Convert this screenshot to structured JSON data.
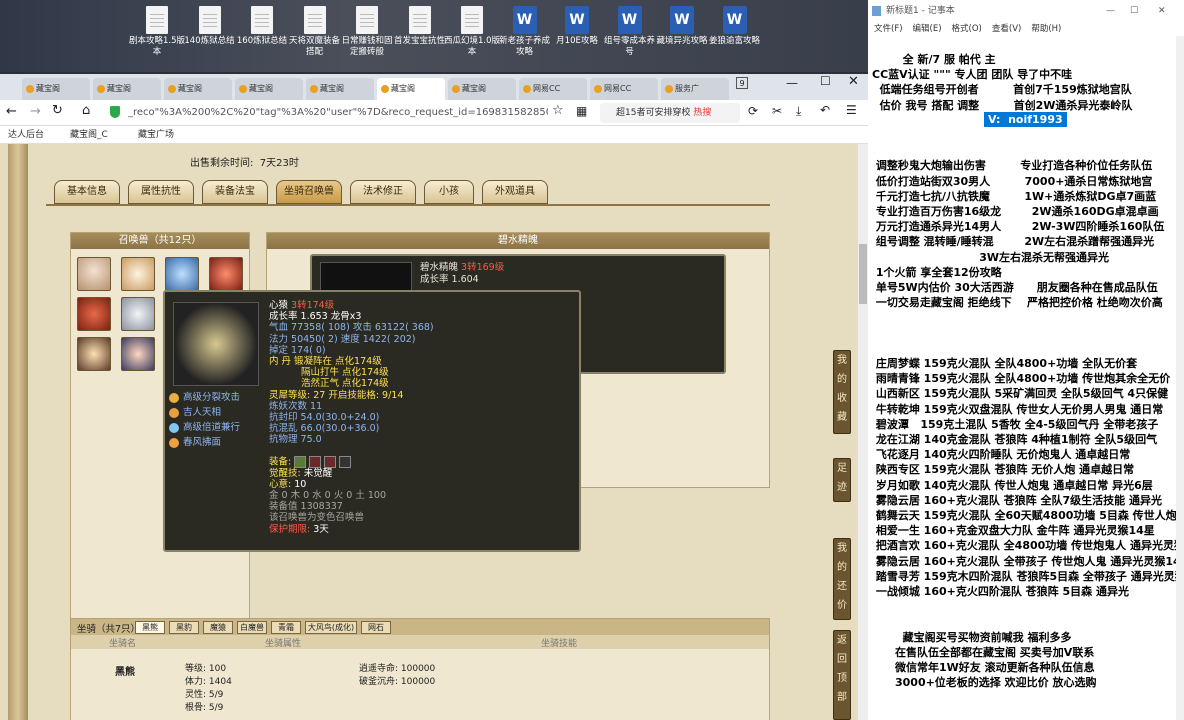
{
  "desktop": {
    "icons": [
      {
        "label": "剧本攻略1.5版本",
        "type": "doc"
      },
      {
        "label": "140炼狱总结",
        "type": "doc"
      },
      {
        "label": "160炼狱总结",
        "type": "doc"
      },
      {
        "label": "天将双魔装备搭配",
        "type": "doc"
      },
      {
        "label": "日常赚钱和固定搬砖般",
        "type": "doc"
      },
      {
        "label": "首发宝宝抗性",
        "type": "doc"
      },
      {
        "label": "西瓜幻境1.0版本",
        "type": "doc"
      },
      {
        "label": "新老孩子养成攻略",
        "type": "word"
      },
      {
        "label": "月10E攻略",
        "type": "word"
      },
      {
        "label": "组号零成本养号",
        "type": "word"
      },
      {
        "label": "藏境异兆攻略",
        "type": "word"
      },
      {
        "label": "姜狼逾富攻略",
        "type": "word"
      }
    ]
  },
  "browser": {
    "tabs": [
      "藏宝阁",
      "藏宝阁",
      "藏宝阁",
      "藏宝阁",
      "藏宝阁",
      "藏宝阁",
      "藏宝阁",
      "网易CC",
      "网易CC",
      "服务广"
    ],
    "tab_count": "9",
    "url": "_reco\"%3A%200%2C%20\"tag\"%3A%20\"user\"%7D&reco_request_id=1698315828504GIEyk",
    "search_text": "超15者可安排穿校",
    "search_hot": "热搜",
    "bookmarks": [
      "达人后台",
      "藏宝阁_C",
      "藏宝广场"
    ]
  },
  "game": {
    "sell_time_label": "出售剩余时间:",
    "sell_time_value": "7天23时",
    "tabs": [
      "基本信息",
      "属性抗性",
      "装备法宝",
      "坐骑召唤兽",
      "法术修正",
      "小孩",
      "外观道具"
    ],
    "summon_panel_title": "召唤兽（共12只）",
    "detail_title": "碧水精魄",
    "mini_popup": {
      "name": "碧水精魄",
      "level": "3转169级",
      "growth": "成长率 1.604"
    },
    "popup": {
      "name": "心猿",
      "level": "3转174级",
      "growth": "成长率 1.653 龙骨x3",
      "hp": "气血 77358( 108) 攻击 63122( 368)",
      "mp": "法力 50450( 2) 速度 1422( 202)",
      "hz": "掉定 174( 0)",
      "neidan1": "内    丹  锻凝阵在 点化174级",
      "neidan2": "隔山打牛 点化174级",
      "neidan3": "浩然正气 点化174级",
      "lingxi": "灵犀等级:   27 开启技能格:   9/14",
      "lianyao": "炼妖次数 11",
      "res1": "抗封印 54.0(30.0+24.0)",
      "res2": "抗混乱 66.0(30.0+36.0)",
      "res3": "抗物理 75.0",
      "skills": [
        "高级分裂攻击",
        "吉人天相",
        "高级倍道兼行",
        "春风拂面"
      ],
      "equip_label": "装备:",
      "awaken_label": "觉醒技:",
      "awaken_value": "未觉醒",
      "xinyi_label": "心意:",
      "xinyi_value": "10",
      "elements": "金 0 木 0 水 0 火 0 土 100",
      "code": "装备值 1308337",
      "note": "该召唤兽为变色召唤兽",
      "remain_label": "保护期限:",
      "remain_value": "3天"
    },
    "mount_panel": {
      "title": "坐骑（共7只）",
      "tabs": [
        "黑熊",
        "黑豹",
        "魔猿",
        "白魔兽",
        "青霜",
        "大风鸟(成化)",
        "网石"
      ],
      "headers": [
        "坐骑名",
        "坐骑属性",
        "坐骑技能"
      ],
      "name": "黑熊",
      "stats": [
        "等级: 100",
        "体力: 1404",
        "灵性: 5/9",
        "根骨: 5/9"
      ],
      "skills": [
        "逍遥寺命: 100000",
        "破釜沉舟: 100000"
      ]
    },
    "side_buttons": [
      "我的收藏",
      "足迹",
      "我的还价",
      "返回顶部"
    ]
  },
  "notepad": {
    "title": "新标题1 - 记事本",
    "menu": [
      "文件(F)",
      "编辑(E)",
      "格式(O)",
      "查看(V)",
      "帮助(H)"
    ],
    "lines": [
      "        全 新/7 服 帕代 主",
      "CC蓝V认证 \"\"\" 专人团 团队 导了中不哇",
      "  低端任务组号开创者         首创7千159炼狱地宫队",
      "  估价 我号 搭配 调整         首创2W通杀异光泰岭队",
      "",
      "",
      "",
      " 调整秒鬼大炮输出伤害         专业打造各种价位任务队伍",
      " 低价打造站街双30男人         7000+通杀日常炼狱地宫",
      " 千元打造七抗/八抗铁魔         1W+通杀炼狱DG卓7画蓝",
      " 专业打造百万伤害16级龙        2W通杀160DG卓混卓画",
      " 万元打造通杀异光14男人        2W-3W四阶睡杀160队伍",
      " 组号调整 混转睡/睡转混        2W左右混杀蹭帮强通异光",
      "                            3W左右混杀无帮强通异光",
      " 1个火箭 享全套12份攻略",
      " 单号5W内估价 30大活西游      朋友圈各种在售成品队伍",
      " 一切交易走藏宝阁 拒绝线下    严格把控价格 杜绝吻次价高",
      "",
      "",
      "",
      " 庄周梦蝶 159克火混队 全队4800+功墙 全队无价套",
      " 雨晴青锋 159克火混队 全队4800+功墙 传世炮其余全无价",
      " 山西新区 159克火混队 5采矿满回灵 全队5级回气 4只保健",
      " 牛转乾坤 159克火双盘混队 传世女人无价男人男鬼 通日常",
      " 碧波潭   159克土混队 5香牧 全4-5级回气丹 全带老孩子",
      " 龙在江湖 140克金混队 苍狼阵 4种植1制符 全队5级回气",
      " 飞花逐月 140克火四阶睡队 无价炮鬼人 通卓越日常",
      " 陕西专区 159克火混队 苍狼阵 无价人炮 通卓越日常",
      " 岁月如歌 140克火混队 传世人炮鬼 通卓越日常 异光6层",
      " 雾隐云居 160+克火混队 苍狼阵 全队7级生活技能 通异光",
      " 鹤舞云天 159克火混队 全60天赋4800功墙 5目森 传世人炮",
      " 相爱一生 160+克金双盘大力队 金牛阵 通异光灵猴14星",
      " 把酒言欢 160+克火混队 全4800功墙 传世炮鬼人 通异光灵猴",
      " 雾隐云居 160+克火混队 全带孩子 传世炮人鬼 通异光灵猴14",
      " 踏雪寻芳 159克木四阶混队 苍狼阵5目森 全带孩子 通异光灵猴",
      " 一战倾城 160+克火四阶混队 苍狼阵 5目森 通异光",
      "",
      "",
      "        藏宝阁买号买物资前喊我 福利多多",
      "      在售队伍全部都在藏宝阁 买卖号加V联系",
      "      微信常年1W好友 滚动更新各种队伍信息",
      "      3000+位老板的选择 欢迎比价 放心选购"
    ],
    "selected": "V:  noif1993"
  }
}
